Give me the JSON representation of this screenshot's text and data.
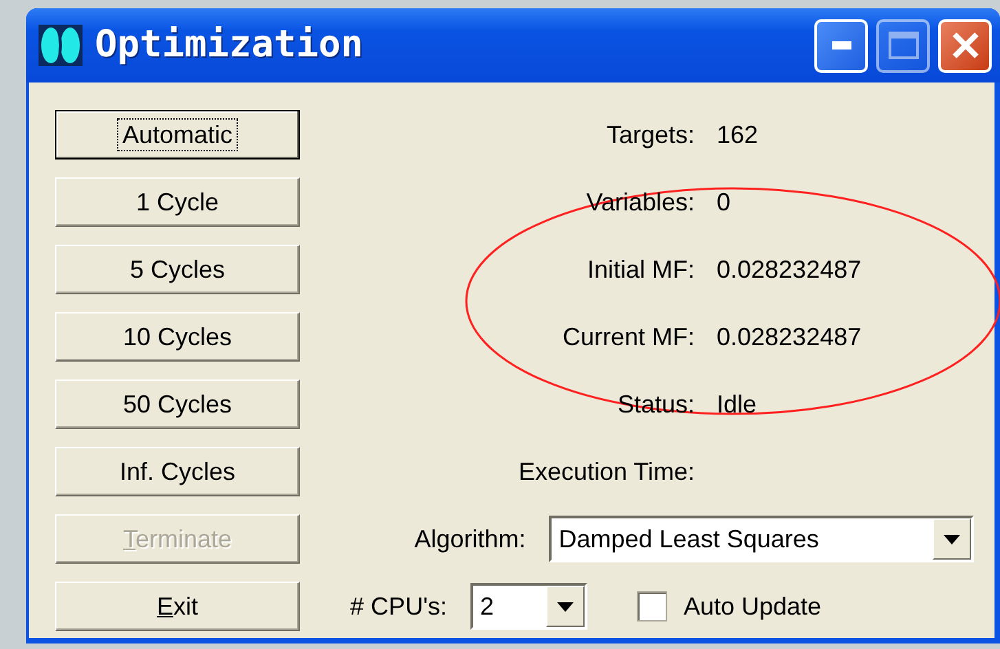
{
  "window": {
    "title": "Optimization"
  },
  "buttons": [
    {
      "label": "Automatic",
      "focused": true,
      "disabled": false,
      "mnemonic": false
    },
    {
      "label": "1 Cycle",
      "focused": false,
      "disabled": false,
      "mnemonic": false
    },
    {
      "label": "5 Cycles",
      "focused": false,
      "disabled": false,
      "mnemonic": false
    },
    {
      "label": "10 Cycles",
      "focused": false,
      "disabled": false,
      "mnemonic": false
    },
    {
      "label": "50 Cycles",
      "focused": false,
      "disabled": false,
      "mnemonic": false
    },
    {
      "label": "Inf. Cycles",
      "focused": false,
      "disabled": false,
      "mnemonic": false
    },
    {
      "label": "Terminate",
      "focused": false,
      "disabled": true,
      "mnemonic": true
    },
    {
      "label": "Exit",
      "focused": false,
      "disabled": false,
      "mnemonic": true
    }
  ],
  "info": [
    {
      "label": "Targets:",
      "value": "162"
    },
    {
      "label": "Variables:",
      "value": "0"
    },
    {
      "label": "Initial MF:",
      "value": "0.028232487"
    },
    {
      "label": "Current MF:",
      "value": "0.028232487"
    },
    {
      "label": "Status:",
      "value": "Idle"
    },
    {
      "label": "Execution Time:"
    }
  ],
  "algorithm": {
    "label": "Algorithm:",
    "value": "Damped Least Squares"
  },
  "cpus": {
    "label": "# CPU's:",
    "value": "2"
  },
  "auto_update": {
    "label": "Auto Update",
    "checked": false
  },
  "annotation_ellipse": true
}
